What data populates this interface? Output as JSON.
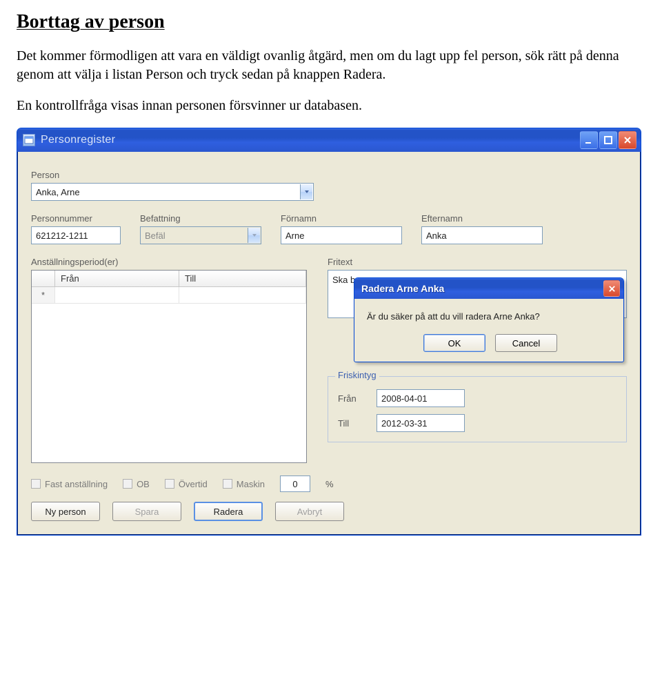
{
  "doc": {
    "heading": "Borttag av person",
    "para1": "Det kommer förmodligen att vara en väldigt ovanlig åtgärd, men om du lagt upp fel person, sök rätt på denna genom att välja i listan Person och tryck sedan på knappen Radera.",
    "para2": "En kontrollfråga visas innan personen försvinner ur databasen."
  },
  "window": {
    "title": "Personregister",
    "labels": {
      "person": "Person",
      "personnummer": "Personnummer",
      "befattning": "Befattning",
      "fornamn": "Förnamn",
      "efternamn": "Efternamn",
      "anstallning": "Anställningsperiod(er)",
      "fritext": "Fritext"
    },
    "fields": {
      "person": "Anka, Arne",
      "personnummer": "621212-1211",
      "befattning": "Befäl",
      "fornamn": "Arne",
      "efternamn": "Anka",
      "fritext": "Ska bara"
    },
    "grid": {
      "col_fran": "Från",
      "col_till": "Till",
      "new_row_marker": "*"
    },
    "friskintyg": {
      "legend": "Friskintyg",
      "fran_label": "Från",
      "fran_value": "2008-04-01",
      "till_label": "Till",
      "till_value": "2012-03-31"
    },
    "checks": {
      "fast": "Fast anställning",
      "ob": "OB",
      "overtid": "Övertid",
      "maskin_label": "Maskin",
      "maskin_value": "0",
      "maskin_unit": "%"
    },
    "buttons": {
      "ny": "Ny person",
      "spara": "Spara",
      "radera": "Radera",
      "avbryt": "Avbryt"
    }
  },
  "dialog": {
    "title": "Radera Arne Anka",
    "message": "Är du säker på att du vill radera Arne Anka?",
    "ok": "OK",
    "cancel": "Cancel"
  }
}
